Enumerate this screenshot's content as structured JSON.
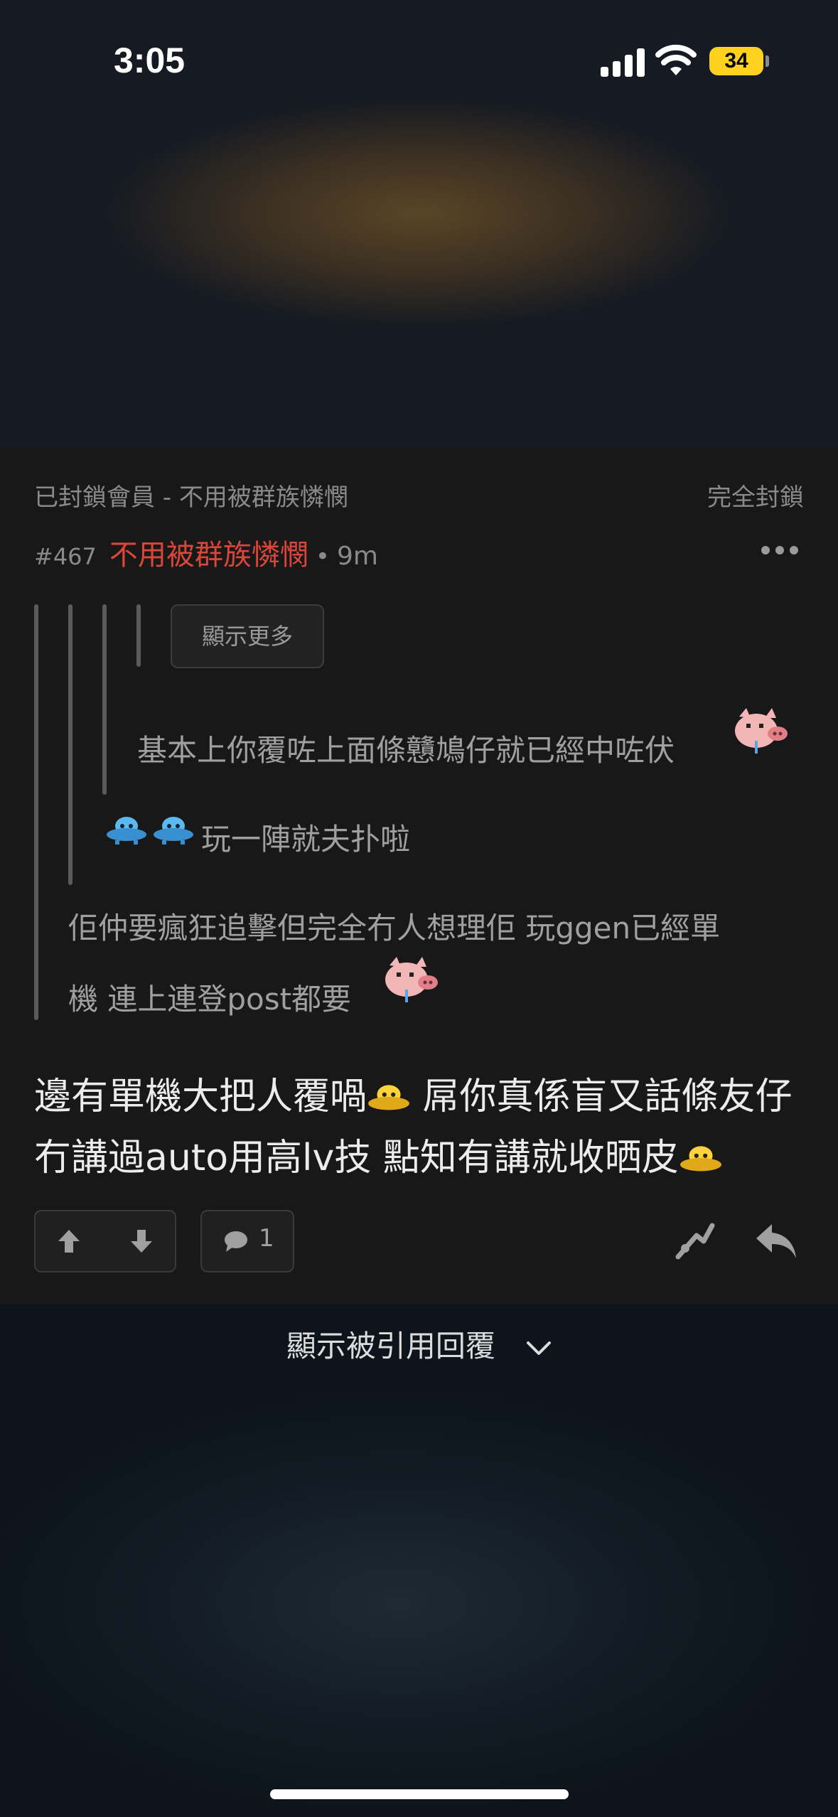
{
  "status_bar": {
    "time": "3:05",
    "battery": "34"
  },
  "post": {
    "blocked_label": "已封鎖會員 - 不用被群族憐憫",
    "block_action": "完全封鎖",
    "number": "#467",
    "username": "不用被群族憐憫",
    "separator": "•",
    "time_ago": "9m",
    "show_more": "顯示更多",
    "quote_level3": "基本上你覆咗上面條戇鳩仔就已經中咗伏",
    "quote_level2": "玩一陣就夫扑啦",
    "quote_level1_line1": "佢仲要瘋狂追擊但完全冇人想理佢 玩ggen已經單",
    "quote_level1_line2": "機 連上連登post都要",
    "body_line1a": "邊有單機大把人覆喎",
    "body_line1b": " 屌你真係盲又話條友仔",
    "body_line2": "冇講過auto用高lv技 點知有講就收晒皮",
    "reply_count": "1"
  },
  "footer": {
    "show_quoted_replies": "顯示被引用回覆"
  },
  "colors": {
    "username": "#d9463a",
    "battery": "#ffd21f",
    "card": "#181818"
  },
  "icons": [
    "upvote-icon",
    "downvote-icon",
    "comment-icon",
    "share-icon",
    "reply-icon",
    "more-icon",
    "chevron-down-icon",
    "pig-emoji-icon",
    "ufo-emoji-icon"
  ]
}
